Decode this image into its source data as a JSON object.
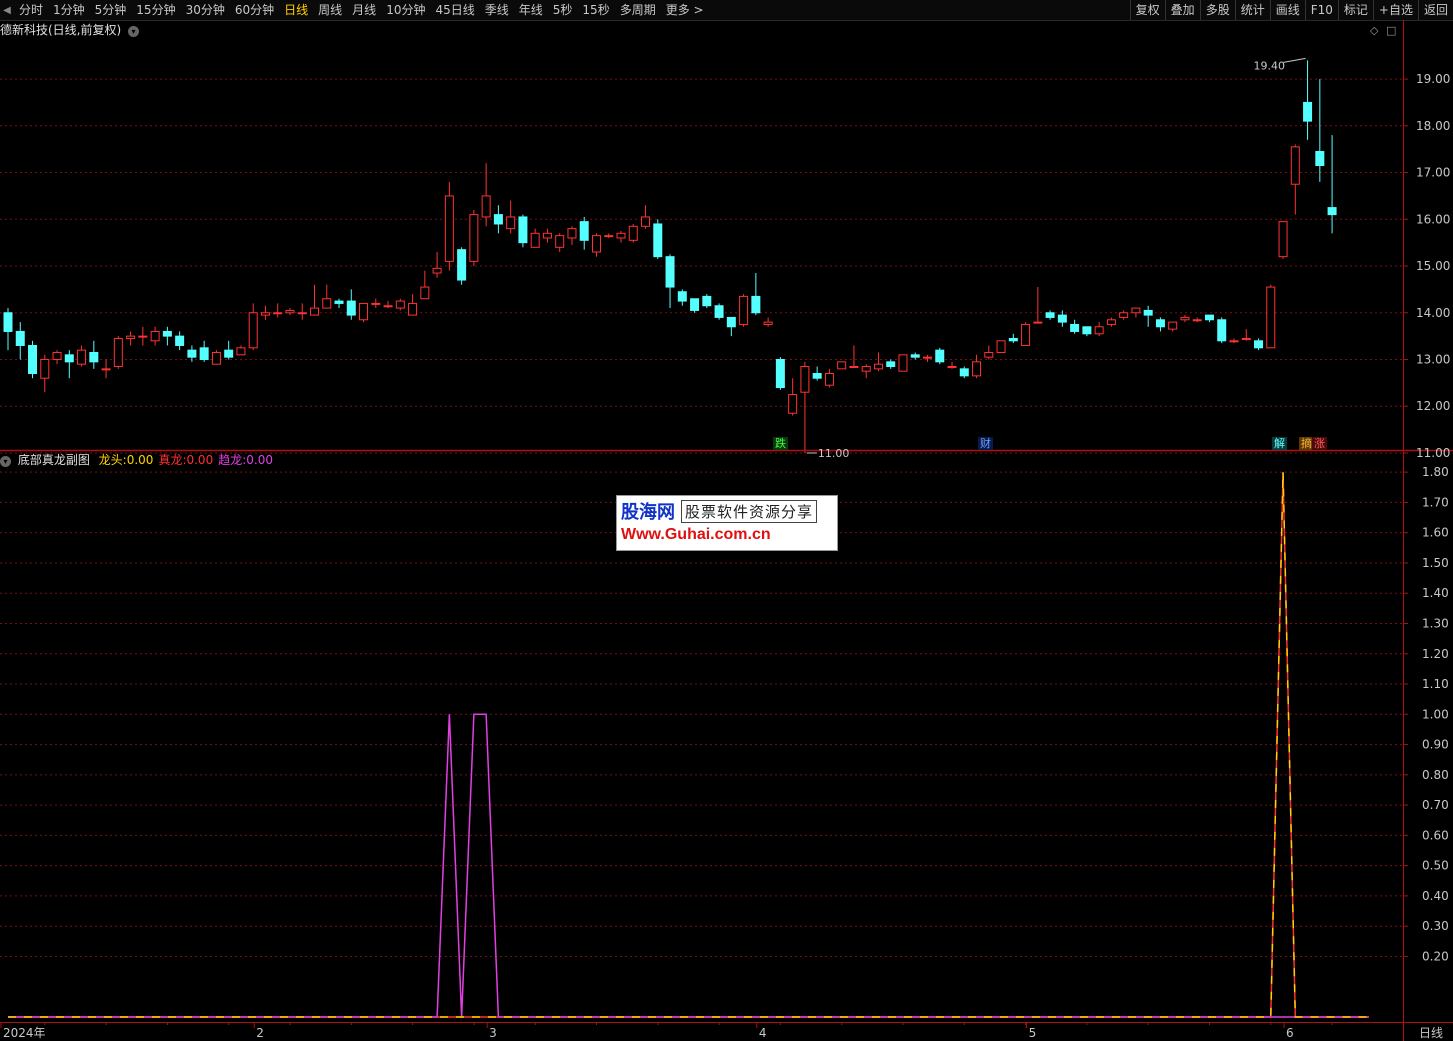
{
  "toolbar": {
    "periods": [
      "分时",
      "1分钟",
      "5分钟",
      "15分钟",
      "30分钟",
      "60分钟",
      "日线",
      "周线",
      "月线",
      "10分钟",
      "45日线",
      "季线",
      "年线",
      "5秒",
      "15秒",
      "多周期",
      "更多 >"
    ],
    "active_period": "日线",
    "tools": [
      "复权",
      "叠加",
      "多股",
      "统计",
      "画线",
      "F10",
      "标记",
      "+自选",
      "返回"
    ]
  },
  "main_chart": {
    "title": "德新科技(日线,前复权)",
    "max_label": "19.40",
    "min_label": "11.00",
    "event_tags": [
      "跌",
      "财",
      "解",
      "摘",
      "涨"
    ],
    "y_ticks": [
      "19.00",
      "18.00",
      "17.00",
      "16.00",
      "15.00",
      "14.00",
      "13.00",
      "12.00",
      "11.00"
    ]
  },
  "sub_chart": {
    "title": "底部真龙副图",
    "legend": [
      {
        "label": "龙头:",
        "value": "0.00",
        "color": "#ffd200"
      },
      {
        "label": "真龙:",
        "value": "0.00",
        "color": "#ff3030"
      },
      {
        "label": "趋龙:",
        "value": "0.00",
        "color": "#e040e0"
      }
    ],
    "y_ticks": [
      "1.80",
      "1.70",
      "1.60",
      "1.50",
      "1.40",
      "1.30",
      "1.20",
      "1.10",
      "1.00",
      "0.90",
      "0.80",
      "0.70",
      "0.60",
      "0.50",
      "0.40",
      "0.30",
      "0.20"
    ]
  },
  "x_axis": {
    "labels": [
      "2024年",
      "2",
      "3",
      "4",
      "5",
      "6"
    ]
  },
  "period_label": "日线",
  "watermark": {
    "logo": "股海网",
    "tagline": "股票软件资源分享",
    "url": "Www.Guhai.com.cn"
  },
  "chart_data": [
    {
      "type": "candlestick",
      "title": "德新科技(日线,前复权)",
      "ylim": [
        10.7,
        19.9
      ],
      "up_color": "#ff3232",
      "down_color": "#54ffff",
      "candles": [
        [
          14.0,
          13.6,
          14.1,
          13.2
        ],
        [
          13.6,
          13.3,
          13.8,
          13.0
        ],
        [
          13.3,
          12.7,
          13.4,
          12.6
        ],
        [
          12.6,
          13.0,
          13.1,
          12.3
        ],
        [
          13.0,
          13.15,
          13.2,
          12.9
        ],
        [
          13.1,
          12.95,
          13.2,
          12.6
        ],
        [
          12.9,
          13.2,
          13.3,
          12.85
        ],
        [
          13.15,
          12.95,
          13.4,
          12.8
        ],
        [
          12.8,
          12.8,
          13.0,
          12.6
        ],
        [
          12.85,
          13.45,
          13.5,
          12.8
        ],
        [
          13.45,
          13.5,
          13.6,
          13.3
        ],
        [
          13.5,
          13.5,
          13.7,
          13.3
        ],
        [
          13.4,
          13.6,
          13.7,
          13.3
        ],
        [
          13.6,
          13.5,
          13.7,
          13.3
        ],
        [
          13.5,
          13.3,
          13.6,
          13.2
        ],
        [
          13.2,
          13.05,
          13.3,
          12.95
        ],
        [
          13.25,
          13.0,
          13.4,
          12.95
        ],
        [
          12.9,
          13.15,
          13.2,
          12.9
        ],
        [
          13.2,
          13.05,
          13.4,
          13.0
        ],
        [
          13.1,
          13.25,
          13.3,
          13.1
        ],
        [
          13.25,
          14.0,
          14.2,
          13.2
        ],
        [
          13.95,
          14.0,
          14.15,
          13.85
        ],
        [
          14.0,
          14.0,
          14.2,
          13.9
        ],
        [
          14.0,
          14.05,
          14.1,
          13.95
        ],
        [
          14.0,
          14.0,
          14.2,
          13.85
        ],
        [
          13.95,
          14.1,
          14.6,
          13.95
        ],
        [
          14.1,
          14.3,
          14.6,
          14.1
        ],
        [
          14.25,
          14.2,
          14.3,
          14.1
        ],
        [
          14.25,
          13.95,
          14.5,
          13.85
        ],
        [
          13.85,
          14.2,
          14.2,
          13.8
        ],
        [
          14.2,
          14.2,
          14.3,
          14.1
        ],
        [
          14.15,
          14.15,
          14.25,
          14.1
        ],
        [
          14.1,
          14.25,
          14.3,
          14.05
        ],
        [
          13.95,
          14.2,
          14.4,
          13.95
        ],
        [
          14.3,
          14.55,
          14.9,
          14.3
        ],
        [
          14.85,
          14.95,
          15.3,
          14.75
        ],
        [
          15.1,
          16.5,
          16.8,
          14.9
        ],
        [
          15.35,
          14.7,
          15.4,
          14.6
        ],
        [
          15.1,
          16.1,
          16.2,
          15.0
        ],
        [
          16.05,
          16.5,
          17.2,
          15.85
        ],
        [
          16.1,
          15.9,
          16.3,
          15.7
        ],
        [
          15.8,
          16.05,
          16.4,
          15.7
        ],
        [
          16.05,
          15.5,
          16.1,
          15.4
        ],
        [
          15.4,
          15.7,
          15.8,
          15.4
        ],
        [
          15.6,
          15.7,
          15.8,
          15.5
        ],
        [
          15.4,
          15.65,
          15.7,
          15.3
        ],
        [
          15.6,
          15.8,
          15.85,
          15.45
        ],
        [
          15.95,
          15.55,
          16.05,
          15.35
        ],
        [
          15.3,
          15.65,
          15.7,
          15.2
        ],
        [
          15.65,
          15.65,
          15.7,
          15.6
        ],
        [
          15.6,
          15.7,
          15.75,
          15.5
        ],
        [
          15.55,
          15.85,
          15.9,
          15.5
        ],
        [
          15.85,
          16.05,
          16.3,
          15.8
        ],
        [
          15.9,
          15.2,
          16.0,
          15.15
        ],
        [
          15.2,
          14.55,
          15.25,
          14.1
        ],
        [
          14.45,
          14.25,
          14.5,
          14.15
        ],
        [
          14.3,
          14.05,
          14.3,
          14.0
        ],
        [
          14.35,
          14.15,
          14.4,
          14.1
        ],
        [
          14.15,
          13.9,
          14.2,
          13.85
        ],
        [
          13.9,
          13.7,
          13.9,
          13.5
        ],
        [
          13.75,
          14.35,
          14.4,
          13.7
        ],
        [
          14.35,
          14.0,
          14.85,
          13.95
        ],
        [
          13.75,
          13.8,
          13.9,
          13.7
        ],
        [
          13.0,
          12.4,
          13.05,
          12.35
        ],
        [
          11.85,
          12.25,
          12.6,
          11.8
        ],
        [
          12.3,
          12.85,
          12.95,
          11.0
        ],
        [
          12.7,
          12.6,
          12.85,
          12.55
        ],
        [
          12.45,
          12.7,
          12.8,
          12.4
        ],
        [
          12.8,
          12.95,
          12.95,
          12.8
        ],
        [
          12.85,
          12.85,
          13.3,
          12.85
        ],
        [
          12.75,
          12.85,
          12.9,
          12.6
        ],
        [
          12.8,
          12.9,
          13.15,
          12.75
        ],
        [
          12.95,
          12.85,
          13.0,
          12.8
        ],
        [
          12.75,
          13.1,
          13.1,
          12.75
        ],
        [
          13.1,
          13.05,
          13.15,
          13.0
        ],
        [
          13.05,
          13.05,
          13.1,
          12.95
        ],
        [
          13.2,
          12.95,
          13.25,
          12.9
        ],
        [
          12.85,
          12.85,
          12.95,
          12.8
        ],
        [
          12.8,
          12.65,
          12.85,
          12.6
        ],
        [
          12.65,
          12.95,
          13.1,
          12.6
        ],
        [
          13.05,
          13.15,
          13.3,
          13.0
        ],
        [
          13.15,
          13.4,
          13.4,
          13.15
        ],
        [
          13.45,
          13.4,
          13.55,
          13.35
        ],
        [
          13.3,
          13.75,
          13.8,
          13.3
        ],
        [
          13.8,
          13.8,
          14.55,
          13.8
        ],
        [
          14.0,
          13.9,
          14.05,
          13.85
        ],
        [
          13.95,
          13.8,
          14.05,
          13.7
        ],
        [
          13.75,
          13.6,
          13.85,
          13.55
        ],
        [
          13.7,
          13.55,
          13.7,
          13.5
        ],
        [
          13.55,
          13.7,
          13.8,
          13.5
        ],
        [
          13.75,
          13.85,
          13.9,
          13.7
        ],
        [
          13.9,
          14.0,
          14.05,
          13.85
        ],
        [
          14.0,
          14.1,
          14.1,
          13.9
        ],
        [
          14.05,
          13.95,
          14.15,
          13.7
        ],
        [
          13.85,
          13.7,
          13.9,
          13.6
        ],
        [
          13.65,
          13.8,
          13.8,
          13.6
        ],
        [
          13.85,
          13.9,
          13.95,
          13.8
        ],
        [
          13.85,
          13.85,
          13.9,
          13.8
        ],
        [
          13.95,
          13.85,
          13.95,
          13.8
        ],
        [
          13.85,
          13.4,
          13.9,
          13.35
        ],
        [
          13.4,
          13.4,
          13.45,
          13.35
        ],
        [
          13.45,
          13.45,
          13.65,
          13.4
        ],
        [
          13.4,
          13.25,
          13.45,
          13.2
        ],
        [
          13.25,
          14.55,
          14.6,
          13.25
        ],
        [
          15.2,
          15.95,
          15.95,
          15.15
        ],
        [
          16.75,
          17.55,
          17.6,
          16.1
        ],
        [
          18.5,
          18.1,
          19.4,
          17.7
        ],
        [
          17.45,
          17.15,
          19.0,
          16.8
        ],
        [
          16.25,
          16.1,
          17.8,
          15.7
        ]
      ]
    },
    {
      "type": "line",
      "title": "底部真龙副图",
      "ylim": [
        0,
        1.85
      ],
      "series": [
        {
          "name": "龙头",
          "color": "#ffd200",
          "points": [
            [
              0,
              0
            ],
            [
              103,
              0
            ],
            [
              104,
              1.8
            ],
            [
              105,
              0
            ],
            [
              111,
              0
            ]
          ]
        },
        {
          "name": "真龙",
          "color": "#ff3030",
          "points": [
            [
              0,
              0
            ],
            [
              103,
              0
            ],
            [
              104,
              1.8
            ],
            [
              105,
              0
            ],
            [
              111,
              0
            ]
          ]
        },
        {
          "name": "趋龙",
          "color": "#e040e0",
          "points": [
            [
              0,
              0
            ],
            [
              35,
              0
            ],
            [
              36,
              1.0
            ],
            [
              37,
              0
            ],
            [
              38,
              1.0
            ],
            [
              39,
              1.0
            ],
            [
              40,
              0
            ],
            [
              111,
              0
            ]
          ]
        }
      ]
    }
  ]
}
